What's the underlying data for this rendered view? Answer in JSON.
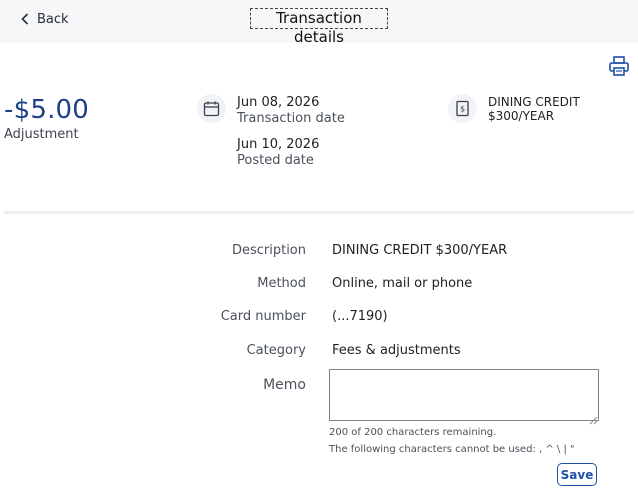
{
  "header": {
    "back_label": "Back",
    "title": "Transaction details"
  },
  "summary": {
    "amount": "-$5.00",
    "amount_label": "Adjustment",
    "transaction_date": "Jun 08, 2026",
    "transaction_date_label": "Transaction date",
    "posted_date": "Jun 10, 2026",
    "posted_date_label": "Posted date",
    "merchant": "DINING CREDIT $300/YEAR",
    "amount_color": "#1f3f87"
  },
  "icons": {
    "back": "chevron-left-icon",
    "print": "printer-icon",
    "date": "calendar-icon",
    "merchant": "receipt-icon"
  },
  "details": {
    "description_label": "Description",
    "description_value": "DINING CREDIT $300/YEAR",
    "method_label": "Method",
    "method_value": "Online, mail or phone",
    "card_label": "Card number",
    "card_value": "(...7190)",
    "category_label": "Category",
    "category_value": "Fees & adjustments",
    "memo_label": "Memo",
    "memo_value": "",
    "memo_remaining": "200 of 200 characters remaining.",
    "memo_restriction": "The following characters cannot be used: , ^ \\ | \"",
    "save_label": "Save"
  }
}
